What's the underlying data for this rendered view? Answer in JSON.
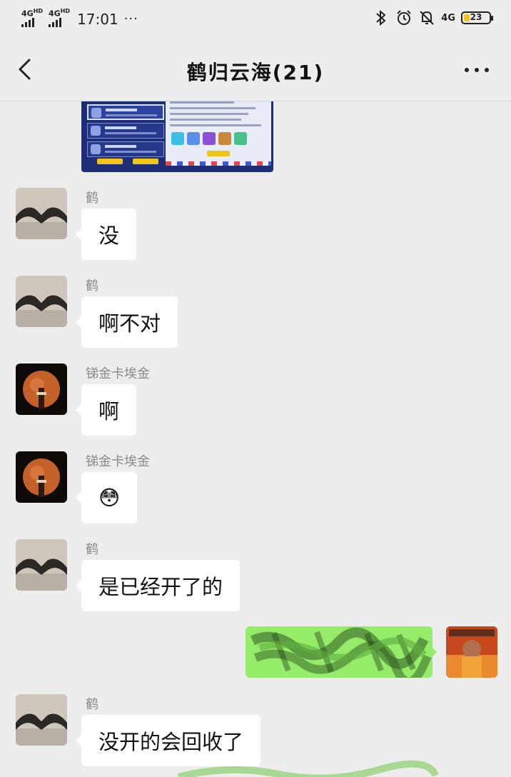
{
  "status_bar": {
    "sim1": "4G",
    "sim1_sup": "HD",
    "sim2": "4G",
    "sim2_sup": "HD",
    "time": "17:01",
    "overflow": "···",
    "network": "4G",
    "battery": "23",
    "battery_level_percent": 23,
    "icons": [
      "bluetooth-icon",
      "alarm-icon",
      "mute-icon"
    ]
  },
  "nav": {
    "title": "鹤归云海(21)",
    "back_icon": "chevron-left-icon",
    "more_icon": "more-dots-icon"
  },
  "messages": [
    {
      "type": "image",
      "sender": "",
      "description_icon": "game-mail-screenshot"
    },
    {
      "type": "text",
      "sender": "鹤",
      "text": "没"
    },
    {
      "type": "text",
      "sender": "鹤",
      "text": "啊不对"
    },
    {
      "type": "text",
      "sender": "锑金卡埃金",
      "text": "啊"
    },
    {
      "type": "text",
      "sender": "锑金卡埃金",
      "text": "😳"
    },
    {
      "type": "text",
      "sender": "鹤",
      "text": "是已经开了的"
    },
    {
      "type": "sent",
      "sender": "",
      "text": ""
    },
    {
      "type": "text",
      "sender": "鹤",
      "text": "没开的会回收了"
    }
  ],
  "colors": {
    "background": "#ededed",
    "incoming_bubble": "#ffffff",
    "outgoing_bubble": "#95ec69",
    "sender_name": "#8a8a8a"
  }
}
